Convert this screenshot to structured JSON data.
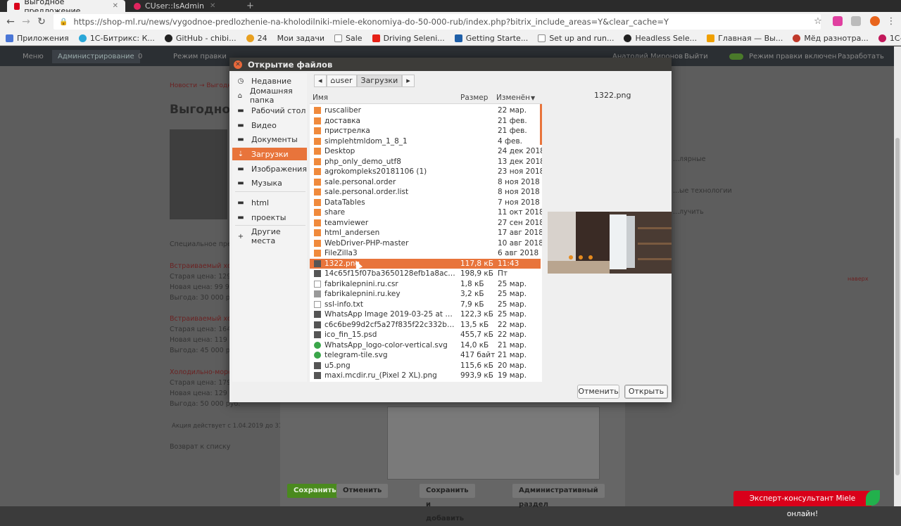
{
  "browser": {
    "tabs": [
      {
        "label": "Выгодное предложение",
        "favicon_color": "#d9001a"
      },
      {
        "label": "CUser::IsAdmin",
        "favicon_color": "#e0245e"
      }
    ],
    "new_tab": "+",
    "url": "https://shop-ml.ru/news/vygodnoe-predlozhenie-na-kholodilniki-miele-ekonomiya-do-50-000-rub/index.php?bitrix_include_areas=Y&clear_cache=Y",
    "bookmarks": [
      {
        "label": "Приложения",
        "icon": "apps-icon"
      },
      {
        "label": "1С-Битрикс: К...",
        "icon": "bitrix-icon"
      },
      {
        "label": "GitHub - chibi...",
        "icon": "github-icon"
      },
      {
        "label": "24",
        "icon": "bitrix24-icon"
      },
      {
        "label": "Мои задачи",
        "icon": "tasks-icon"
      },
      {
        "label": "Sale",
        "icon": "page-icon"
      },
      {
        "label": "Driving Seleni...",
        "icon": "youtube-icon"
      },
      {
        "label": "Getting Starte...",
        "icon": "selenium-icon"
      },
      {
        "label": "Set up and run...",
        "icon": "page-icon"
      },
      {
        "label": "Headless Sele...",
        "icon": "github-icon"
      },
      {
        "label": "Главная — Вы...",
        "icon": "site-icon"
      },
      {
        "label": "Мёд разнотра...",
        "icon": "honey-icon"
      },
      {
        "label": "1С-Битрикс Ра...",
        "icon": "bitrix-icon"
      }
    ]
  },
  "admin_bar": {
    "menu": "Меню",
    "administration": "Администрирование",
    "count": "0",
    "view_mode": "Режим правки",
    "logout": "Выйти",
    "edit_toggle": "Режим правки включен",
    "design": "Разработать",
    "user": "Анатолий Миронов"
  },
  "page": {
    "breadcrumb": "Новости → Выгодное",
    "title": "Выгодно",
    "intro": "Специальное пред",
    "offers": [
      {
        "title": "Встраиваемый хо",
        "old": "Старая цена: 129 9",
        "new": "Новая цена: 99 90",
        "save": "Выгода: 30 000 руб."
      },
      {
        "title": "Встраиваемый хо",
        "old": "Старая цена: 164 9",
        "new": "Новая цена: 119 9",
        "save": "Выгода: 45 000 руб."
      },
      {
        "title": "Холодильно-моро",
        "old": "Старая цена: 179 9",
        "new": "Новая цена: 129 9",
        "save": "Выгода: 50 000 руб."
      }
    ],
    "note": "Акция действует с 1.04.2019 до 31.12.2",
    "back_link": "Возврат к списку",
    "right_fragments": [
      "...лярные",
      "...ые технологии",
      "...лучить"
    ],
    "side_label": "наверх"
  },
  "editor_buttons": {
    "save": "Сохранить",
    "cancel": "Отменить",
    "save_add": "Сохранить и добавить",
    "admin_section": "Административный раздел"
  },
  "consultant": "Эксперт-консультант Miele онлайн!",
  "dialog": {
    "title": "Открытие файлов",
    "places": [
      {
        "label": "Недавние",
        "icon": "clock-icon"
      },
      {
        "label": "Домашняя папка",
        "icon": "home-icon"
      },
      {
        "label": "Рабочий стол",
        "icon": "folder-icon"
      },
      {
        "label": "Видео",
        "icon": "folder-icon"
      },
      {
        "label": "Документы",
        "icon": "folder-icon"
      },
      {
        "label": "Загрузки",
        "icon": "download-icon",
        "selected": true
      },
      {
        "label": "Изображения",
        "icon": "folder-icon"
      },
      {
        "label": "Музыка",
        "icon": "folder-icon"
      }
    ],
    "bookmarks": [
      {
        "label": "html",
        "icon": "folder-icon"
      },
      {
        "label": "проекты",
        "icon": "folder-icon"
      }
    ],
    "other": "Другие места",
    "path": {
      "home": "user",
      "current": "Загрузки"
    },
    "columns": {
      "name": "Имя",
      "size": "Размер",
      "modified": "Изменён"
    },
    "files": [
      {
        "name": "ruscaliber",
        "size": "",
        "modified": "22 мар.",
        "type": "folder"
      },
      {
        "name": "доставка",
        "size": "",
        "modified": "21 фев.",
        "type": "folder"
      },
      {
        "name": "пристрелка",
        "size": "",
        "modified": "21 фев.",
        "type": "folder"
      },
      {
        "name": "simplehtmldom_1_8_1",
        "size": "",
        "modified": "4 фев.",
        "type": "folder"
      },
      {
        "name": "Desktop",
        "size": "",
        "modified": "24 дек 2018",
        "type": "folder"
      },
      {
        "name": "php_only_demo_utf8",
        "size": "",
        "modified": "13 дек 2018",
        "type": "folder"
      },
      {
        "name": "agrokompleks20181106 (1)",
        "size": "",
        "modified": "23 ноя 2018",
        "type": "folder"
      },
      {
        "name": "sale.personal.order",
        "size": "",
        "modified": "8 ноя 2018",
        "type": "folder"
      },
      {
        "name": "sale.personal.order.list",
        "size": "",
        "modified": "8 ноя 2018",
        "type": "folder"
      },
      {
        "name": "DataTables",
        "size": "",
        "modified": "7 ноя 2018",
        "type": "folder"
      },
      {
        "name": "share",
        "size": "",
        "modified": "11 окт 2018",
        "type": "folder"
      },
      {
        "name": "teamviewer",
        "size": "",
        "modified": "27 сен 2018",
        "type": "folder"
      },
      {
        "name": "html_andersen",
        "size": "",
        "modified": "17 авг 2018",
        "type": "folder"
      },
      {
        "name": "WebDriver-PHP-master",
        "size": "",
        "modified": "10 авг 2018",
        "type": "folder"
      },
      {
        "name": "FileZilla3",
        "size": "",
        "modified": "6 авг 2018",
        "type": "folder"
      },
      {
        "name": "1322.png",
        "size": "117,8 кБ",
        "modified": "11:43",
        "type": "image",
        "selected": true
      },
      {
        "name": "14c65f15f07ba3650128efb1a8ac6f8e...",
        "size": "198,9 кБ",
        "modified": "Пт",
        "type": "image"
      },
      {
        "name": "fabrikalepnini.ru.csr",
        "size": "1,8 кБ",
        "modified": "25 мар.",
        "type": "text"
      },
      {
        "name": "fabrikalepnini.ru.key",
        "size": "3,2 кБ",
        "modified": "25 мар.",
        "type": "key"
      },
      {
        "name": "ssl-info.txt",
        "size": "7,9 кБ",
        "modified": "25 мар.",
        "type": "text"
      },
      {
        "name": "WhatsApp Image 2019-03-25 at 11.44....",
        "size": "122,3 кБ",
        "modified": "25 мар.",
        "type": "image"
      },
      {
        "name": "c6c6be99d2cf5a27f835f22c332be24b...",
        "size": "13,5 кБ",
        "modified": "22 мар.",
        "type": "image"
      },
      {
        "name": "ico_fin_15.psd",
        "size": "455,7 кБ",
        "modified": "22 мар.",
        "type": "image"
      },
      {
        "name": "WhatsApp_logo-color-vertical.svg",
        "size": "14,0 кБ",
        "modified": "21 мар.",
        "type": "svg"
      },
      {
        "name": "telegram-tile.svg",
        "size": "417 байт",
        "modified": "21 мар.",
        "type": "svg"
      },
      {
        "name": "u5.png",
        "size": "115,6 кБ",
        "modified": "20 мар.",
        "type": "image"
      },
      {
        "name": "maxi.mcdir.ru_(Pixel 2 XL).png",
        "size": "993,9 кБ",
        "modified": "19 мар.",
        "type": "image"
      }
    ],
    "preview_name": "1322.png",
    "cancel": "Отменить",
    "open": "Открыть"
  },
  "colors": {
    "accent": "#e8743b",
    "folder": "#f08a3c",
    "admin_save": "#4a8a1e",
    "consultant": "#d9001a"
  }
}
